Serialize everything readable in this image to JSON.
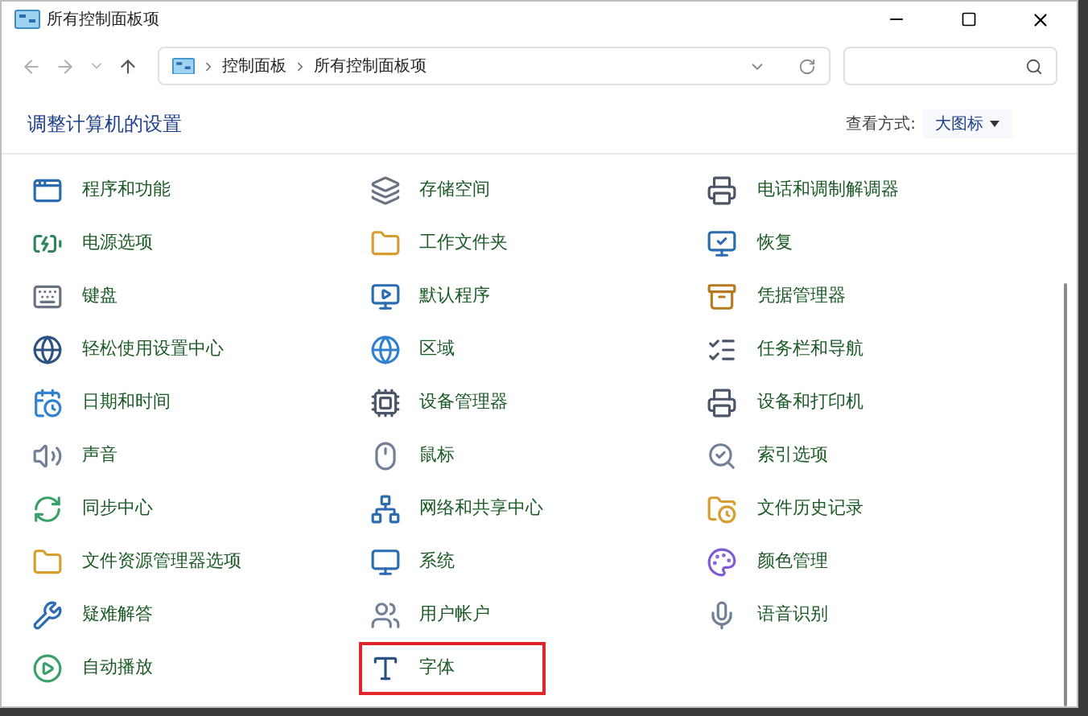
{
  "window": {
    "title": "所有控制面板项"
  },
  "breadcrumb": [
    "控制面板",
    "所有控制面板项"
  ],
  "heading": "调整计算机的设置",
  "view_by": {
    "label": "查看方式:",
    "value": "大图标"
  },
  "items": [
    {
      "label": "程序和功能",
      "highlighted": false
    },
    {
      "label": "存储空间",
      "highlighted": false
    },
    {
      "label": "电话和调制解调器",
      "highlighted": false
    },
    {
      "label": "电源选项",
      "highlighted": false
    },
    {
      "label": "工作文件夹",
      "highlighted": false
    },
    {
      "label": "恢复",
      "highlighted": false
    },
    {
      "label": "键盘",
      "highlighted": false
    },
    {
      "label": "默认程序",
      "highlighted": false
    },
    {
      "label": "凭据管理器",
      "highlighted": false
    },
    {
      "label": "轻松使用设置中心",
      "highlighted": false
    },
    {
      "label": "区域",
      "highlighted": false
    },
    {
      "label": "任务栏和导航",
      "highlighted": false
    },
    {
      "label": "日期和时间",
      "highlighted": false
    },
    {
      "label": "设备管理器",
      "highlighted": false
    },
    {
      "label": "设备和打印机",
      "highlighted": false
    },
    {
      "label": "声音",
      "highlighted": false
    },
    {
      "label": "鼠标",
      "highlighted": false
    },
    {
      "label": "索引选项",
      "highlighted": false
    },
    {
      "label": "同步中心",
      "highlighted": false
    },
    {
      "label": "网络和共享中心",
      "highlighted": false
    },
    {
      "label": "文件历史记录",
      "highlighted": false
    },
    {
      "label": "文件资源管理器选项",
      "highlighted": false
    },
    {
      "label": "系统",
      "highlighted": false
    },
    {
      "label": "颜色管理",
      "highlighted": false
    },
    {
      "label": "疑难解答",
      "highlighted": false
    },
    {
      "label": "用户帐户",
      "highlighted": false
    },
    {
      "label": "语音识别",
      "highlighted": false
    },
    {
      "label": "自动播放",
      "highlighted": false
    },
    {
      "label": "字体",
      "highlighted": true
    }
  ]
}
